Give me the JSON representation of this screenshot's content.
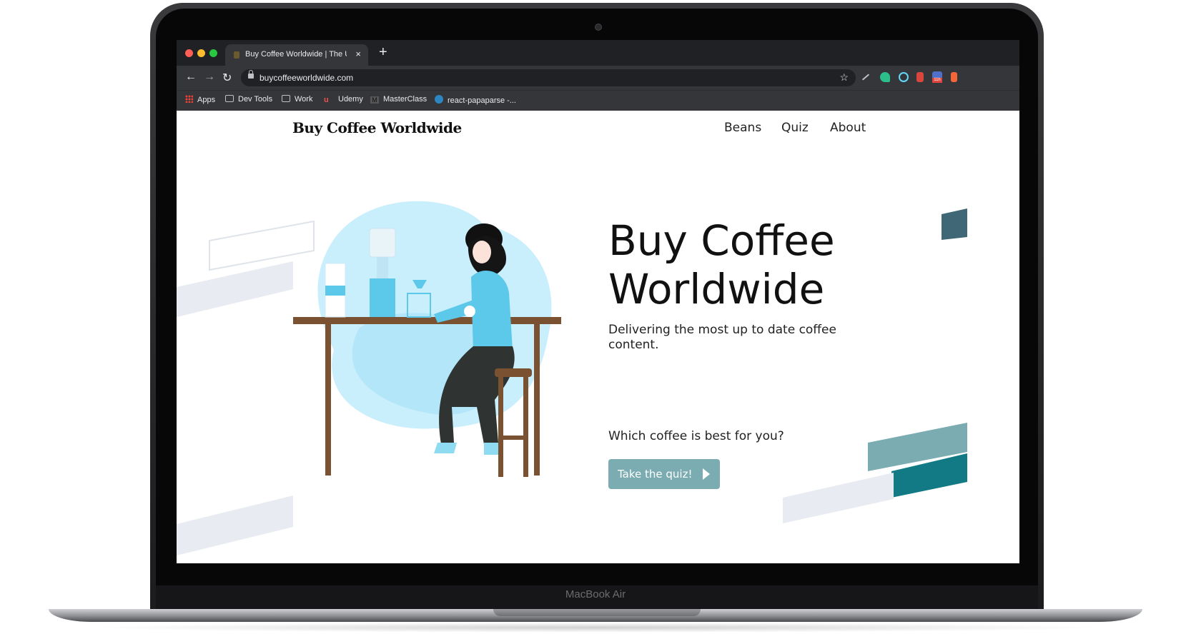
{
  "laptop": {
    "model_label": "MacBook Air"
  },
  "browser": {
    "tab_title": "Buy Coffee Worldwide | The Ul",
    "tab_close": "×",
    "new_tab": "+",
    "url": "buycoffeeworldwide.com",
    "back_glyph": "←",
    "forward_glyph": "→",
    "reload_glyph": "↻",
    "star_glyph": "☆",
    "bookmarks": [
      {
        "label": "Apps",
        "icon": "apps-grid-icon"
      },
      {
        "label": "Dev Tools",
        "icon": "folder-icon"
      },
      {
        "label": "Work",
        "icon": "folder-icon"
      },
      {
        "label": "Udemy",
        "icon": "udemy-icon"
      },
      {
        "label": "MasterClass",
        "icon": "masterclass-icon"
      },
      {
        "label": "react-papaparse -...",
        "icon": "papaparse-icon"
      }
    ],
    "extension_badge": "11h"
  },
  "site": {
    "logo": "Buy Coffee Worldwide",
    "nav": [
      {
        "label": "Beans"
      },
      {
        "label": "Quiz"
      },
      {
        "label": "About"
      }
    ],
    "hero": {
      "title": "Buy Coffee Worldwide",
      "subtitle": "Delivering the most up to date coffee content."
    },
    "quiz": {
      "question": "Which coffee is best for you?",
      "button_label": "Take the quiz!"
    }
  },
  "colors": {
    "accent": "#7aacb2",
    "teal_dark": "#127a85",
    "slate": "#3f6775",
    "illustration_blue": "#5cc9ea",
    "wood": "#7a5231"
  }
}
